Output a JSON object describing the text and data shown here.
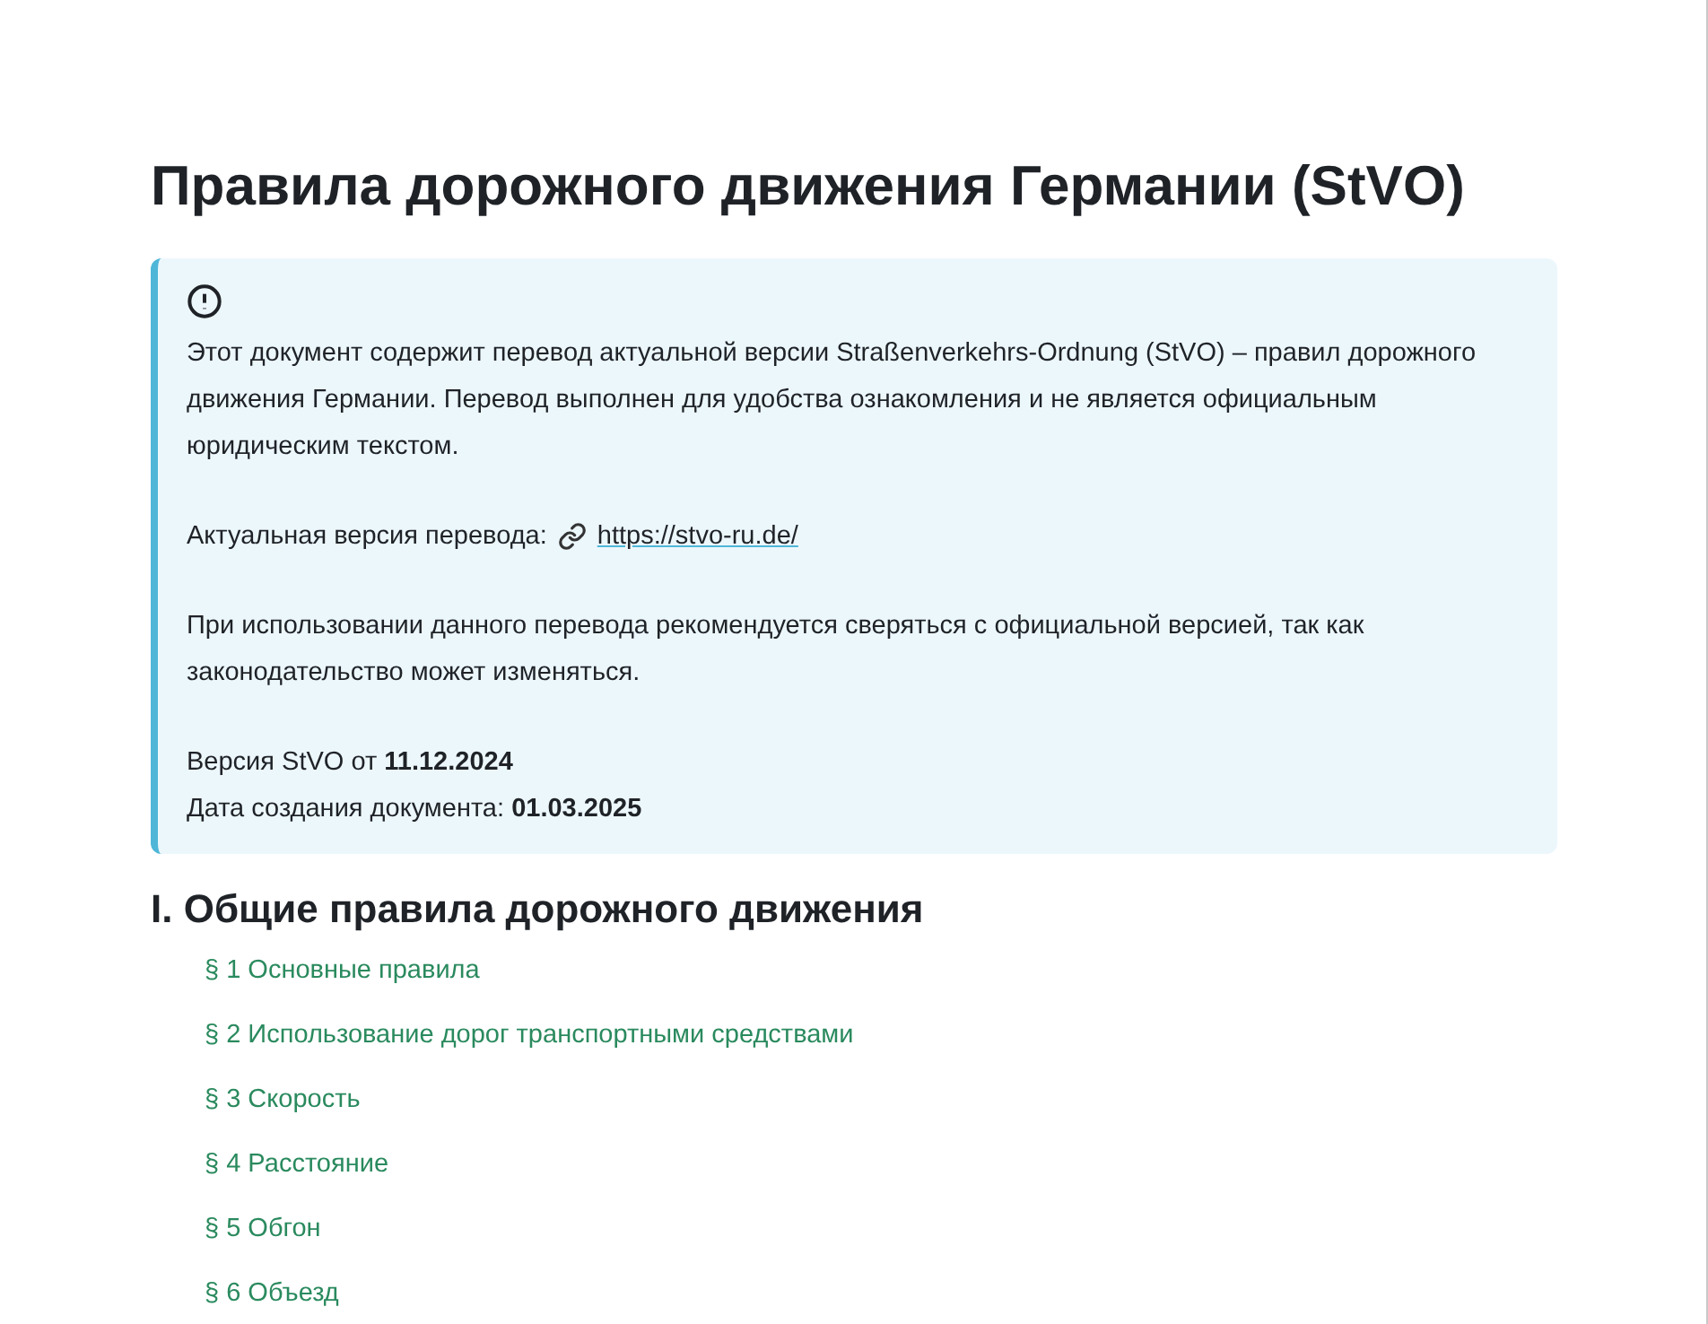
{
  "title": "Правила дорожного движения Германии (StVO)",
  "notice": {
    "paragraphs": [
      "Этот документ содержит перевод актуальной версии Straßenverkehrs-Ordnung (StVO) – правил дорожного движения Германии. Перевод выполнен для удобства ознакомления и не является официальным юридическим текстом."
    ],
    "link_label": "Актуальная версия перевода:",
    "link": "https://stvo-ru.de/",
    "note": "При использовании данного перевода рекомендуется сверяться с официальной версией, так как законодательство может изменяться.",
    "version_lines": [
      "Версия StVO от **11.12.2024**",
      "Дата создания документа: **01.03.2025**"
    ]
  },
  "section": {
    "heading": "I. Общие правила дорожного движения",
    "items": [
      "§ 1 Основные правила",
      "§ 2 Использование дорог транспортными средствами",
      "§ 3 Скорость",
      "§ 4 Расстояние",
      "§ 5 Обгон",
      "§ 6 Объезд"
    ]
  }
}
